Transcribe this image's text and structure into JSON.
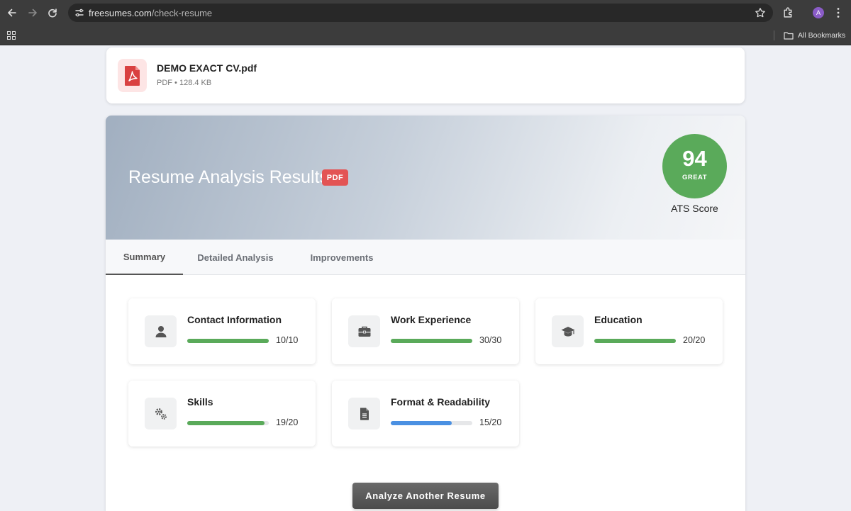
{
  "browser": {
    "url_host": "freesumes.com",
    "url_path": "/check-resume",
    "avatar_letter": "A",
    "bookmarks_label": "All Bookmarks"
  },
  "file": {
    "name": "DEMO EXACT CV.pdf",
    "meta": "PDF • 128.4 KB"
  },
  "results": {
    "title": "Resume Analysis Results",
    "badge": "PDF",
    "score": "94",
    "grade": "GREAT",
    "score_caption": "ATS Score"
  },
  "tabs": [
    "Summary",
    "Detailed Analysis",
    "Improvements"
  ],
  "sections": [
    {
      "title": "Contact Information",
      "score_text": "10/10",
      "fraction": 1.0,
      "icon": "person-icon",
      "color": "#5aaa5a"
    },
    {
      "title": "Work Experience",
      "score_text": "30/30",
      "fraction": 1.0,
      "icon": "briefcase-icon",
      "color": "#5aaa5a"
    },
    {
      "title": "Education",
      "score_text": "20/20",
      "fraction": 1.0,
      "icon": "graduation-cap-icon",
      "color": "#5aaa5a"
    },
    {
      "title": "Skills",
      "score_text": "19/20",
      "fraction": 0.95,
      "icon": "gears-icon",
      "color": "#5aaa5a"
    },
    {
      "title": "Format & Readability",
      "score_text": "15/20",
      "fraction": 0.75,
      "icon": "document-icon",
      "color": "#4a90e2"
    }
  ],
  "actions": {
    "analyze_another": "Analyze Another Resume"
  }
}
